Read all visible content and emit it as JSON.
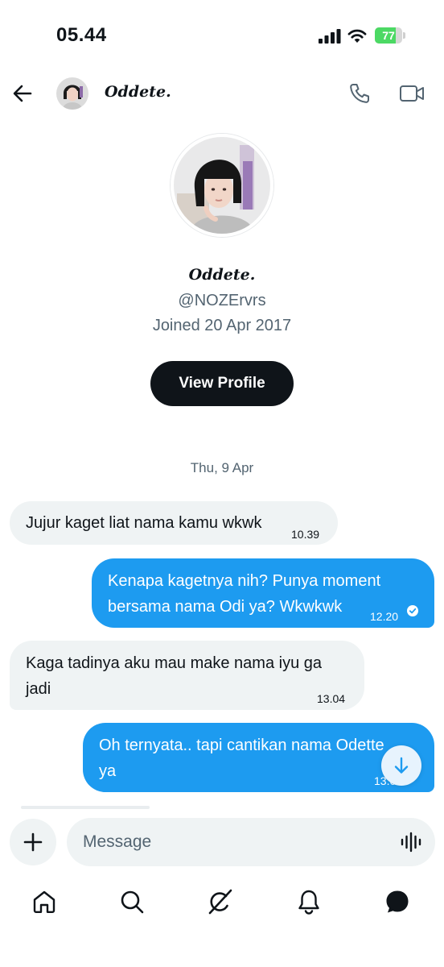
{
  "status_bar": {
    "time": "05.44",
    "battery_percent": "77",
    "battery_level": 0.77
  },
  "header": {
    "name": "Oddete.",
    "icons": [
      "back-arrow-icon",
      "phone-icon",
      "video-camera-icon"
    ]
  },
  "profile": {
    "name": "Oddete.",
    "handle": "@NOZErvrs",
    "joined": "Joined 20 Apr 2017",
    "button_label": "View Profile"
  },
  "conversation": {
    "date_separator": "Thu, 9 Apr",
    "messages": [
      {
        "direction": "incoming",
        "lines": [
          "Jujur kaget liat nama kamu wkwk"
        ],
        "time": "10.39"
      },
      {
        "direction": "outgoing",
        "lines": [
          "Kenapa kagetnya nih? Punya moment",
          "bersama nama Odi ya? Wkwkwk"
        ],
        "time": "12.20",
        "read": true
      },
      {
        "direction": "incoming",
        "lines": [
          "Kaga tadinya aku mau make nama iyu ga",
          "jadi"
        ],
        "time": "13.04"
      },
      {
        "direction": "outgoing",
        "lines": [
          "Oh ternyata.. tapi cantikan nama Odette",
          "ya"
        ],
        "time": "13.06"
      }
    ]
  },
  "composer": {
    "placeholder": "Message",
    "value": ""
  },
  "bottom_nav": [
    "home-icon",
    "search-icon",
    "grok-icon",
    "notifications-icon",
    "messages-icon"
  ],
  "colors": {
    "accent": "#1d9bf0",
    "incoming_bubble": "#eff3f4",
    "text": "#0f1419",
    "muted": "#536471",
    "button_dark": "#0f1419",
    "battery": "#4cd964"
  }
}
